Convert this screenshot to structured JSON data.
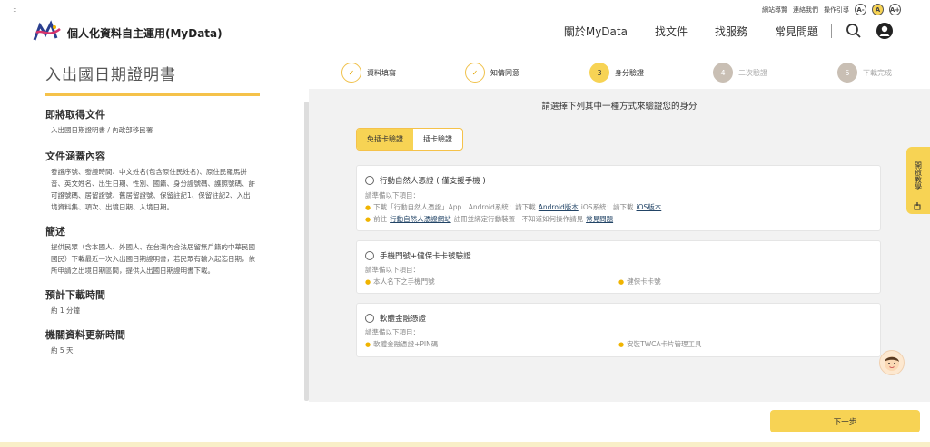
{
  "utility": {
    "sitemap": "網站導覽",
    "contact": "連絡我們",
    "guide": "操作引導",
    "font_sizes": [
      "A-",
      "A",
      "A+"
    ]
  },
  "brand": {
    "name": "個人化資料自主運用(MyData)"
  },
  "nav": {
    "items": [
      "關於MyData",
      "找文件",
      "找服務",
      "常見問題"
    ],
    "icons": [
      "search-icon",
      "user-icon"
    ]
  },
  "left": {
    "title": "入出國日期證明書",
    "sections": [
      {
        "heading": "即將取得文件",
        "body": "入出國日期證明書 / 內政部移民署"
      },
      {
        "heading": "文件涵蓋內容",
        "body": "發證序號、發證時間、中文姓名(包含原住民姓名)、原住民羅馬拼音、英文姓名、出生日期、性別、國籍、身分證號碼、護照號碼、許可證號碼、居留證號、舊居留證號、保留註記1、保留註記2、入出境資料集、項次、出境日期、入境日期。"
      },
      {
        "heading": "簡述",
        "body": "提供民眾（含本國人、外國人、在台灣內合法居留無戶籍的中華民國國民）下載最近一次入出國日期證明書，若民眾有輸入起迄日期，依所申請之出境日期區間，提供入出國日期證明書下載。"
      },
      {
        "heading": "預計下載時間",
        "body": "約 1 分鐘"
      },
      {
        "heading": "機關資料更新時間",
        "body": "約 5 天"
      }
    ]
  },
  "steps": [
    {
      "num": "✓",
      "label": "資料填寫",
      "state": "done"
    },
    {
      "num": "✓",
      "label": "知情同意",
      "state": "done"
    },
    {
      "num": "3",
      "label": "身分驗證",
      "state": "current"
    },
    {
      "num": "4",
      "label": "二次驗證",
      "state": "todo"
    },
    {
      "num": "5",
      "label": "下載完成",
      "state": "todo"
    }
  ],
  "main": {
    "question": "請選擇下列其中一種方式來驗證您的身分",
    "tabs": [
      "免插卡驗證",
      "插卡驗證"
    ],
    "active_tab": 0,
    "options": [
      {
        "title": "行動自然人憑證 ( 僅支援手機 )",
        "sub": "請準備以下項目：",
        "line1_prefix": "下載「行動自然人憑證」App　Android系統：請下載",
        "line1_link1": "Android版本",
        "line1_mid": "iOS系統：請下載",
        "line1_link2": "iOS版本",
        "line2_prefix": "前往",
        "line2_link1": "行動自然人憑證網站",
        "line2_mid": "註冊並綁定行動裝置　不知道如何操作請見",
        "line2_link2": "常見問題"
      },
      {
        "title": "手機門號+健保卡卡號驗證",
        "sub": "請準備以下項目：",
        "item1": "本人名下之手機門號",
        "item2": "健保卡卡號"
      },
      {
        "title": "軟體金融憑證",
        "sub": "請準備以下項目：",
        "item1": "軟體金融憑證+PIN碼",
        "item2": "安裝TWCA卡片管理工具"
      }
    ]
  },
  "next_button": "下一步",
  "side_tab": "開啟教學",
  "colors": {
    "accent": "#f7d354",
    "underline": "#f5c24a",
    "todo_step": "#c9bfb4"
  }
}
